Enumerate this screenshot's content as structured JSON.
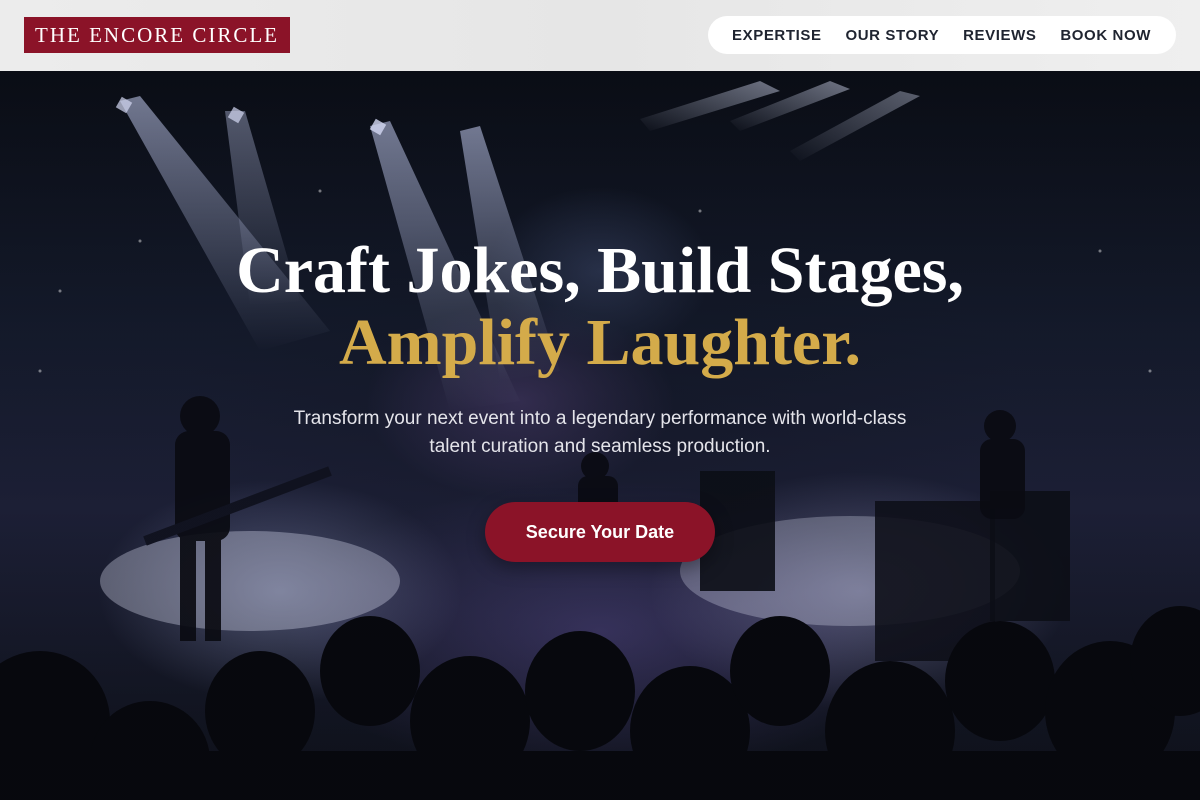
{
  "brand": {
    "name": "THE ENCORE CIRCLE",
    "color": "#8b1328"
  },
  "nav": {
    "items": [
      {
        "label": "EXPERTISE"
      },
      {
        "label": "OUR STORY"
      },
      {
        "label": "REVIEWS"
      },
      {
        "label": "BOOK NOW"
      }
    ]
  },
  "hero": {
    "headline_line1": "Craft Jokes, Build Stages,",
    "headline_line2": "Amplify Laughter.",
    "subheadline": "Transform your next event into a legendary performance with world-class talent curation and seamless production.",
    "cta_label": "Secure Your Date",
    "background": "concert-stage-photo",
    "accent_color": "#d4ab4a"
  }
}
